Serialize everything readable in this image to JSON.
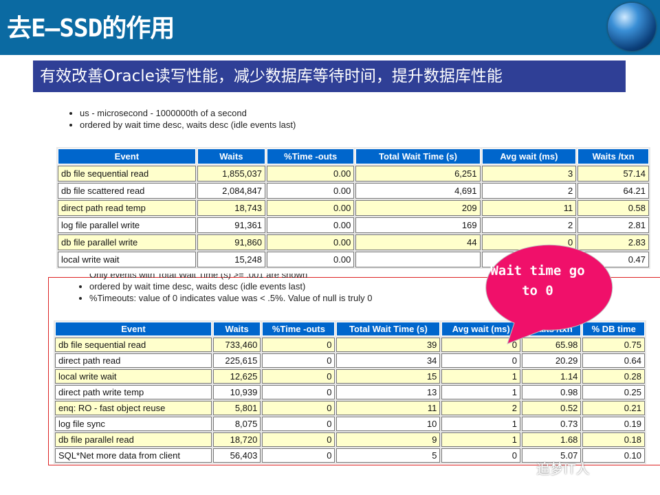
{
  "header": {
    "title": "去E—SSD的作用",
    "subtitle": "有效改善Oracle读写性能，减少数据库等待时间，提升数据库性能",
    "logo_icon": "globe-icon"
  },
  "before": {
    "notes": [
      "us - microsecond - 1000000th of a second",
      "ordered by wait time desc, waits desc (idle events last)"
    ],
    "columns": [
      "Event",
      "Waits",
      "%Time -outs",
      "Total Wait Time (s)",
      "Avg wait (ms)",
      "Waits /txn"
    ],
    "rows": [
      [
        "db file sequential read",
        "1,855,037",
        "0.00",
        "6,251",
        "3",
        "57.14"
      ],
      [
        "db file scattered read",
        "2,084,847",
        "0.00",
        "4,691",
        "2",
        "64.21"
      ],
      [
        "direct path read temp",
        "18,743",
        "0.00",
        "209",
        "11",
        "0.58"
      ],
      [
        "log file parallel write",
        "91,361",
        "0.00",
        "169",
        "2",
        "2.81"
      ],
      [
        "db file parallel write",
        "91,860",
        "0.00",
        "44",
        "0",
        "2.83"
      ],
      [
        "local write wait",
        "15,248",
        "0.00",
        "",
        "2",
        "0.47"
      ]
    ]
  },
  "after": {
    "notes": [
      "Only events with Total Wait Time (s) >= .001 are shown",
      "ordered by wait time desc, waits desc (idle events last)",
      "%Timeouts: value of 0 indicates value was < .5%. Value of null is truly 0"
    ],
    "columns": [
      "Event",
      "Waits",
      "%Time -outs",
      "Total Wait Time (s)",
      "Avg wait (ms)",
      "Waits /txn",
      "% DB time"
    ],
    "rows": [
      [
        "db file sequential read",
        "733,460",
        "0",
        "39",
        "0",
        "65.98",
        "0.75"
      ],
      [
        "direct path read",
        "225,615",
        "0",
        "34",
        "0",
        "20.29",
        "0.64"
      ],
      [
        "local write wait",
        "12,625",
        "0",
        "15",
        "1",
        "1.14",
        "0.28"
      ],
      [
        "direct path write temp",
        "10,939",
        "0",
        "13",
        "1",
        "0.98",
        "0.25"
      ],
      [
        "enq: RO - fast object reuse",
        "5,801",
        "0",
        "11",
        "2",
        "0.52",
        "0.21"
      ],
      [
        "log file sync",
        "8,075",
        "0",
        "10",
        "1",
        "0.73",
        "0.19"
      ],
      [
        "db file parallel read",
        "18,720",
        "0",
        "9",
        "1",
        "1.68",
        "0.18"
      ],
      [
        "SQL*Net more data from client",
        "56,403",
        "0",
        "5",
        "0",
        "5.07",
        "0.10"
      ]
    ]
  },
  "callout": {
    "text": "Wait time go to 0",
    "color": "#f0106a"
  },
  "watermark": "追梦IT人",
  "colors": {
    "header_bar": "#0b6aa2",
    "subtitle_bg": "#2f3f96",
    "table_header": "#0066cc",
    "row_alt": "#ffffcc",
    "highlight_box": "#dd2222"
  }
}
